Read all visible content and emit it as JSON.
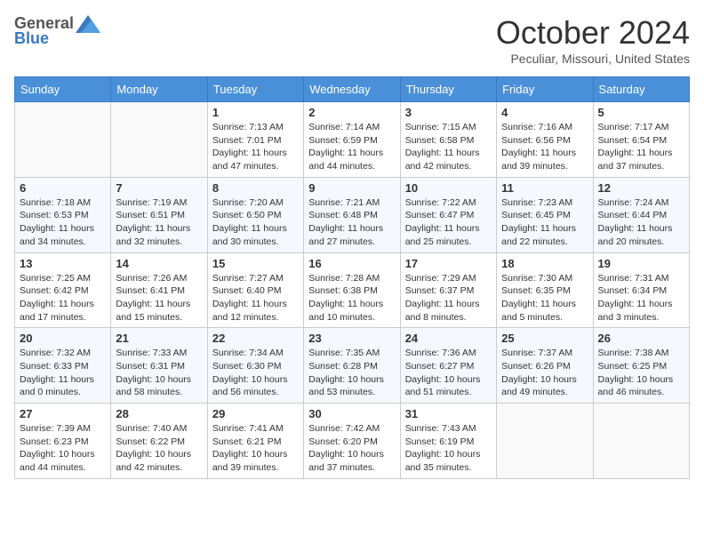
{
  "header": {
    "logo_general": "General",
    "logo_blue": "Blue",
    "month_title": "October 2024",
    "location": "Peculiar, Missouri, United States"
  },
  "days_of_week": [
    "Sunday",
    "Monday",
    "Tuesday",
    "Wednesday",
    "Thursday",
    "Friday",
    "Saturday"
  ],
  "weeks": [
    [
      {
        "day": "",
        "empty": true
      },
      {
        "day": "",
        "empty": true
      },
      {
        "day": "1",
        "sunrise": "Sunrise: 7:13 AM",
        "sunset": "Sunset: 7:01 PM",
        "daylight": "Daylight: 11 hours and 47 minutes."
      },
      {
        "day": "2",
        "sunrise": "Sunrise: 7:14 AM",
        "sunset": "Sunset: 6:59 PM",
        "daylight": "Daylight: 11 hours and 44 minutes."
      },
      {
        "day": "3",
        "sunrise": "Sunrise: 7:15 AM",
        "sunset": "Sunset: 6:58 PM",
        "daylight": "Daylight: 11 hours and 42 minutes."
      },
      {
        "day": "4",
        "sunrise": "Sunrise: 7:16 AM",
        "sunset": "Sunset: 6:56 PM",
        "daylight": "Daylight: 11 hours and 39 minutes."
      },
      {
        "day": "5",
        "sunrise": "Sunrise: 7:17 AM",
        "sunset": "Sunset: 6:54 PM",
        "daylight": "Daylight: 11 hours and 37 minutes."
      }
    ],
    [
      {
        "day": "6",
        "sunrise": "Sunrise: 7:18 AM",
        "sunset": "Sunset: 6:53 PM",
        "daylight": "Daylight: 11 hours and 34 minutes."
      },
      {
        "day": "7",
        "sunrise": "Sunrise: 7:19 AM",
        "sunset": "Sunset: 6:51 PM",
        "daylight": "Daylight: 11 hours and 32 minutes."
      },
      {
        "day": "8",
        "sunrise": "Sunrise: 7:20 AM",
        "sunset": "Sunset: 6:50 PM",
        "daylight": "Daylight: 11 hours and 30 minutes."
      },
      {
        "day": "9",
        "sunrise": "Sunrise: 7:21 AM",
        "sunset": "Sunset: 6:48 PM",
        "daylight": "Daylight: 11 hours and 27 minutes."
      },
      {
        "day": "10",
        "sunrise": "Sunrise: 7:22 AM",
        "sunset": "Sunset: 6:47 PM",
        "daylight": "Daylight: 11 hours and 25 minutes."
      },
      {
        "day": "11",
        "sunrise": "Sunrise: 7:23 AM",
        "sunset": "Sunset: 6:45 PM",
        "daylight": "Daylight: 11 hours and 22 minutes."
      },
      {
        "day": "12",
        "sunrise": "Sunrise: 7:24 AM",
        "sunset": "Sunset: 6:44 PM",
        "daylight": "Daylight: 11 hours and 20 minutes."
      }
    ],
    [
      {
        "day": "13",
        "sunrise": "Sunrise: 7:25 AM",
        "sunset": "Sunset: 6:42 PM",
        "daylight": "Daylight: 11 hours and 17 minutes."
      },
      {
        "day": "14",
        "sunrise": "Sunrise: 7:26 AM",
        "sunset": "Sunset: 6:41 PM",
        "daylight": "Daylight: 11 hours and 15 minutes."
      },
      {
        "day": "15",
        "sunrise": "Sunrise: 7:27 AM",
        "sunset": "Sunset: 6:40 PM",
        "daylight": "Daylight: 11 hours and 12 minutes."
      },
      {
        "day": "16",
        "sunrise": "Sunrise: 7:28 AM",
        "sunset": "Sunset: 6:38 PM",
        "daylight": "Daylight: 11 hours and 10 minutes."
      },
      {
        "day": "17",
        "sunrise": "Sunrise: 7:29 AM",
        "sunset": "Sunset: 6:37 PM",
        "daylight": "Daylight: 11 hours and 8 minutes."
      },
      {
        "day": "18",
        "sunrise": "Sunrise: 7:30 AM",
        "sunset": "Sunset: 6:35 PM",
        "daylight": "Daylight: 11 hours and 5 minutes."
      },
      {
        "day": "19",
        "sunrise": "Sunrise: 7:31 AM",
        "sunset": "Sunset: 6:34 PM",
        "daylight": "Daylight: 11 hours and 3 minutes."
      }
    ],
    [
      {
        "day": "20",
        "sunrise": "Sunrise: 7:32 AM",
        "sunset": "Sunset: 6:33 PM",
        "daylight": "Daylight: 11 hours and 0 minutes."
      },
      {
        "day": "21",
        "sunrise": "Sunrise: 7:33 AM",
        "sunset": "Sunset: 6:31 PM",
        "daylight": "Daylight: 10 hours and 58 minutes."
      },
      {
        "day": "22",
        "sunrise": "Sunrise: 7:34 AM",
        "sunset": "Sunset: 6:30 PM",
        "daylight": "Daylight: 10 hours and 56 minutes."
      },
      {
        "day": "23",
        "sunrise": "Sunrise: 7:35 AM",
        "sunset": "Sunset: 6:28 PM",
        "daylight": "Daylight: 10 hours and 53 minutes."
      },
      {
        "day": "24",
        "sunrise": "Sunrise: 7:36 AM",
        "sunset": "Sunset: 6:27 PM",
        "daylight": "Daylight: 10 hours and 51 minutes."
      },
      {
        "day": "25",
        "sunrise": "Sunrise: 7:37 AM",
        "sunset": "Sunset: 6:26 PM",
        "daylight": "Daylight: 10 hours and 49 minutes."
      },
      {
        "day": "26",
        "sunrise": "Sunrise: 7:38 AM",
        "sunset": "Sunset: 6:25 PM",
        "daylight": "Daylight: 10 hours and 46 minutes."
      }
    ],
    [
      {
        "day": "27",
        "sunrise": "Sunrise: 7:39 AM",
        "sunset": "Sunset: 6:23 PM",
        "daylight": "Daylight: 10 hours and 44 minutes."
      },
      {
        "day": "28",
        "sunrise": "Sunrise: 7:40 AM",
        "sunset": "Sunset: 6:22 PM",
        "daylight": "Daylight: 10 hours and 42 minutes."
      },
      {
        "day": "29",
        "sunrise": "Sunrise: 7:41 AM",
        "sunset": "Sunset: 6:21 PM",
        "daylight": "Daylight: 10 hours and 39 minutes."
      },
      {
        "day": "30",
        "sunrise": "Sunrise: 7:42 AM",
        "sunset": "Sunset: 6:20 PM",
        "daylight": "Daylight: 10 hours and 37 minutes."
      },
      {
        "day": "31",
        "sunrise": "Sunrise: 7:43 AM",
        "sunset": "Sunset: 6:19 PM",
        "daylight": "Daylight: 10 hours and 35 minutes."
      },
      {
        "day": "",
        "empty": true
      },
      {
        "day": "",
        "empty": true
      }
    ]
  ]
}
